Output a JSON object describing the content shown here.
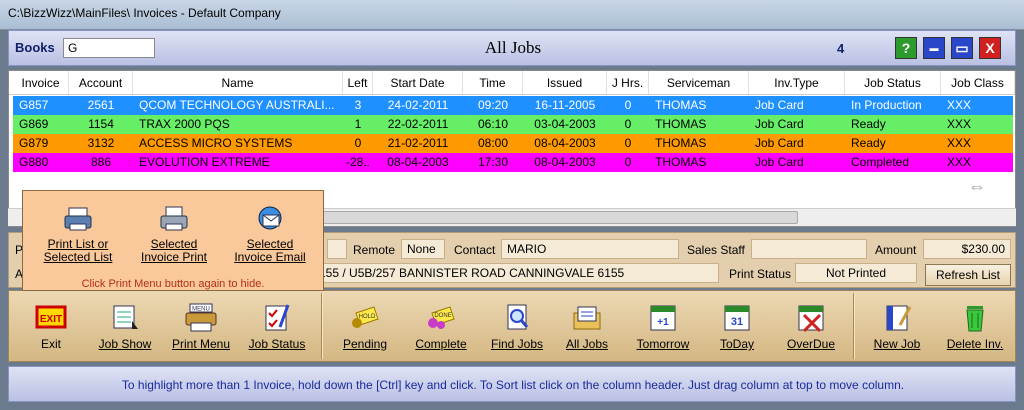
{
  "window": {
    "title": "C:\\BizzWizz\\MainFiles\\ Invoices - Default Company"
  },
  "header": {
    "books_label": "Books",
    "books_value": "G",
    "title": "All Jobs",
    "count": "4",
    "buttons": {
      "help": "?",
      "minimize": "▬",
      "maximize": "▭",
      "close": "X"
    }
  },
  "grid": {
    "columns": [
      "Invoice",
      "Account",
      "Name",
      "Left",
      "Start Date",
      "Time",
      "Issued",
      "J Hrs.",
      "Serviceman",
      "Inv.Type",
      "Job Status",
      "Job Class"
    ],
    "rows": [
      {
        "cells": [
          "G857",
          "2561",
          "QCOM TECHNOLOGY AUSTRALI...",
          "3",
          "24-02-2011",
          "09:20",
          "16-11-2005",
          "0",
          "THOMAS",
          "Job Card",
          "In Production",
          "XXX"
        ],
        "bg": "#1e90ff",
        "fg": "#ffffff"
      },
      {
        "cells": [
          "G869",
          "1154",
          "TRAX 2000 PQS",
          "1",
          "22-02-2011",
          "06:10",
          "03-04-2003",
          "0",
          "THOMAS",
          "Job Card",
          "Ready",
          "XXX"
        ],
        "bg": "#66ee66",
        "fg": "#000000"
      },
      {
        "cells": [
          "G879",
          "3132",
          "ACCESS MICRO SYSTEMS",
          "0",
          "21-02-2011",
          "08:00",
          "08-04-2003",
          "0",
          "THOMAS",
          "Job Card",
          "Ready",
          "XXX"
        ],
        "bg": "#ff9900",
        "fg": "#000000"
      },
      {
        "cells": [
          "G880",
          "886",
          "EVOLUTION EXTREME",
          "-28..",
          "08-04-2003",
          "17:30",
          "08-04-2003",
          "0",
          "THOMAS",
          "Job Card",
          "Completed",
          "XXX"
        ],
        "bg": "#ff00ff",
        "fg": "#000000"
      }
    ],
    "nav_icon": "⇔"
  },
  "details": {
    "remote_label": "Remote",
    "remote_value": "None",
    "contact_label": "Contact",
    "contact_value": "MARIO",
    "sales_staff_label": "Sales Staff",
    "sales_staff_value": "",
    "amount_label": "Amount",
    "amount_value": "$230.00",
    "address_value": "155  /  U5B/257 BANNISTER ROAD  CANNINGVALE 6155",
    "print_status_label": "Print Status",
    "print_status_value": "Not Printed",
    "refresh_label": "Refresh List",
    "left_label_1": "P",
    "left_label_2": "A"
  },
  "print_popup": {
    "items": [
      {
        "line1": "Print List or",
        "line2": "Selected List",
        "icon": "print-list-icon"
      },
      {
        "line1": "Selected",
        "line2": "Invoice Print",
        "icon": "printer-icon"
      },
      {
        "line1": "Selected",
        "line2": "Invoice Email",
        "icon": "email-icon"
      }
    ],
    "note": "Click Print Menu button again to hide."
  },
  "toolbar": {
    "exit": "Exit",
    "job_show": "Job Show",
    "print_menu": "Print Menu",
    "job_status": "Job Status",
    "pending": "Pending",
    "complete": "Complete",
    "find_jobs": "Find Jobs",
    "all_jobs": "All Jobs",
    "tomorrow": "Tomorrow",
    "today": "ToDay",
    "overdue": "OverDue",
    "new_job": "New Job",
    "delete_inv": "Delete Inv."
  },
  "status": {
    "text": "To highlight more than 1 Invoice, hold down the [Ctrl] key and click.   To Sort list click on the column header.   Just drag column at top to move column."
  }
}
